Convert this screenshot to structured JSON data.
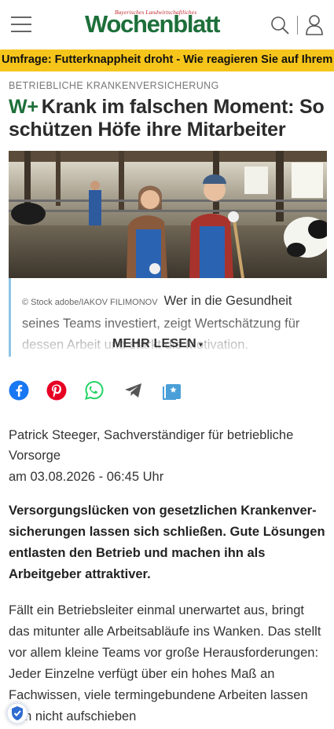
{
  "header": {
    "logo_subtitle": "Bayerisches Landwirtschaftliches",
    "logo_title": "Wochenblatt",
    "menu_icon": "hamburger-menu-icon",
    "search_icon": "search-icon",
    "user_icon": "user-icon"
  },
  "ticker": {
    "text": "Umfrage: Futterknappheit droht - Wie reagieren Sie auf Ihrem Betrieb?"
  },
  "article": {
    "kicker": "BETRIEBLICHE KRANKENVERSICHERUNG",
    "premium_mark": "W+",
    "headline": "Krank im falschen Moment: So schützen Höfe ihre Mitarbeiter",
    "image_credit": "© Stock adobe/IAKOV FILIMONOV",
    "teaser": "Wer in die Gesundheit seines Teams investiert, zeigt Wertschätzung für dessen Arbeit und stärkt die Motivation.",
    "read_more": "MEHR LESEN",
    "author": "Patrick Steeger, Sachverständiger für betriebliche Vorsorge",
    "date": "am 03.08.2026 - 06:45 Uhr",
    "lead": "Versorgungslücken von gesetzlichen Krankenver­sicherungen lassen sich schließen. Gute Lösun­gen entlasten den Betrieb und machen ihn als Arbeitgeber attraktiver.",
    "body": "Fällt ein Betriebsleiter einmal unerwartet aus, bringt das mitunter alle Arbeitsabläufe ins Wanken. Das stellt vor allem kleine Teams vor große Herausforderungen: Jeder Einzelne verfügt über ein hohes Maß an Fachwissen, viele termin­gebundene Arbeiten lassen sich nicht aufschieben"
  },
  "share": {
    "icons": [
      "facebook-icon",
      "pinterest-icon",
      "whatsapp-icon",
      "telegram-icon",
      "bookmark-icon"
    ],
    "colors": {
      "facebook": "#1877f2",
      "pinterest": "#e60023",
      "whatsapp": "#25d366",
      "telegram": "#555555",
      "bookmark": "#4a9fd8"
    }
  },
  "colors": {
    "brand_green": "#1d6f3a",
    "ticker_yellow": "#f6c51b",
    "teaser_border": "#8ec5e6"
  }
}
